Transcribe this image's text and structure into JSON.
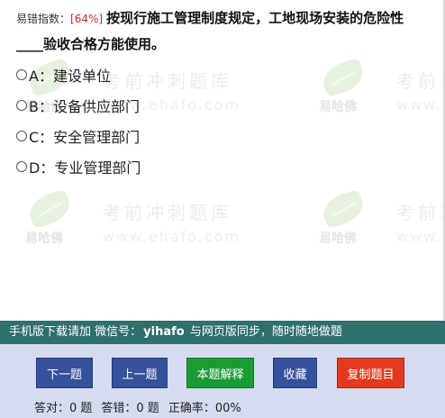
{
  "question": {
    "difficulty_label": "易错指数：",
    "difficulty_value": "[64%]",
    "text_line1": "按现行施工管理制度规定，工地现场安装的危险性",
    "text_line2": "____验收合格方能使用。"
  },
  "options": [
    {
      "label": "A：建设单位"
    },
    {
      "label": "B：设备供应部门"
    },
    {
      "label": "C：安全管理部门"
    },
    {
      "label": "D：专业管理部门"
    }
  ],
  "watermark": {
    "logo_text": "易哈佛",
    "title": "考前冲刺题库",
    "url": "www.ehafo.com"
  },
  "banner": {
    "prefix": "手机版下载请加 微信号：",
    "wechat_id": "yihafo",
    "suffix": "与网页版同步，随时随地做题"
  },
  "buttons": {
    "next": "下一题",
    "prev": "上一题",
    "explain": "本题解释",
    "favorite": "收藏",
    "copy": "复制题目"
  },
  "stats": {
    "correct": "答对：0 题",
    "wrong": "答错：0 题",
    "accuracy": "正确率：00%"
  },
  "colors": {
    "banner_bg": "#2f6f6c",
    "footer_bg": "#d6dcef",
    "btn_blue": "#35519b",
    "btn_green": "#1a9b34",
    "btn_red": "#e33a1f",
    "difficulty": "#c62828"
  }
}
